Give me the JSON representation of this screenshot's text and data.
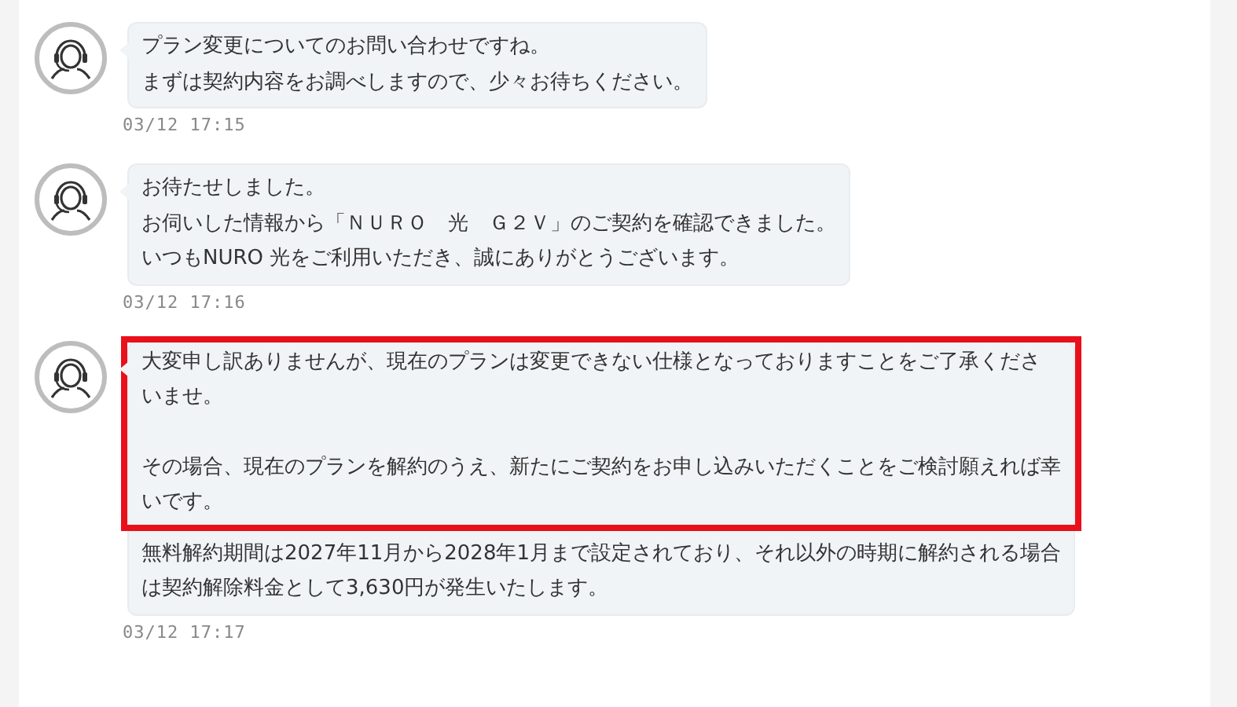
{
  "messages": [
    {
      "blocks": [
        {
          "highlighted": false,
          "paragraphs": [
            [
              "プラン変更についてのお問い合わせですね。",
              "まずは契約内容をお調べしますので、少々お待ちください。"
            ]
          ]
        }
      ],
      "time": "03/12 17:15"
    },
    {
      "blocks": [
        {
          "highlighted": false,
          "paragraphs": [
            [
              "お待たせしました。",
              "お伺いした情報から「ＮＵＲＯ　光　Ｇ２Ｖ」のご契約を確認できました。",
              "いつもNURO 光をご利用いただき、誠にありがとうございます。"
            ]
          ]
        }
      ],
      "time": "03/12 17:16"
    },
    {
      "blocks": [
        {
          "highlighted": true,
          "paragraphs": [
            [
              "大変申し訳ありませんが、現在のプランは変更できない仕様となっておりますことをご了承くださ",
              "いませ。"
            ],
            [
              "その場合、現在のプランを解約のうえ、新たにご契約をお申し込みいただくことをご検討願えれば幸",
              "いです。"
            ]
          ]
        },
        {
          "highlighted": false,
          "paragraphs": [
            [
              "無料解約期間は2027年11月から2028年1月まで設定されており、それ以外の時期に解約される場合",
              "は契約解除料金として3,630円が発生いたします。"
            ]
          ]
        }
      ],
      "time": "03/12 17:17"
    }
  ]
}
